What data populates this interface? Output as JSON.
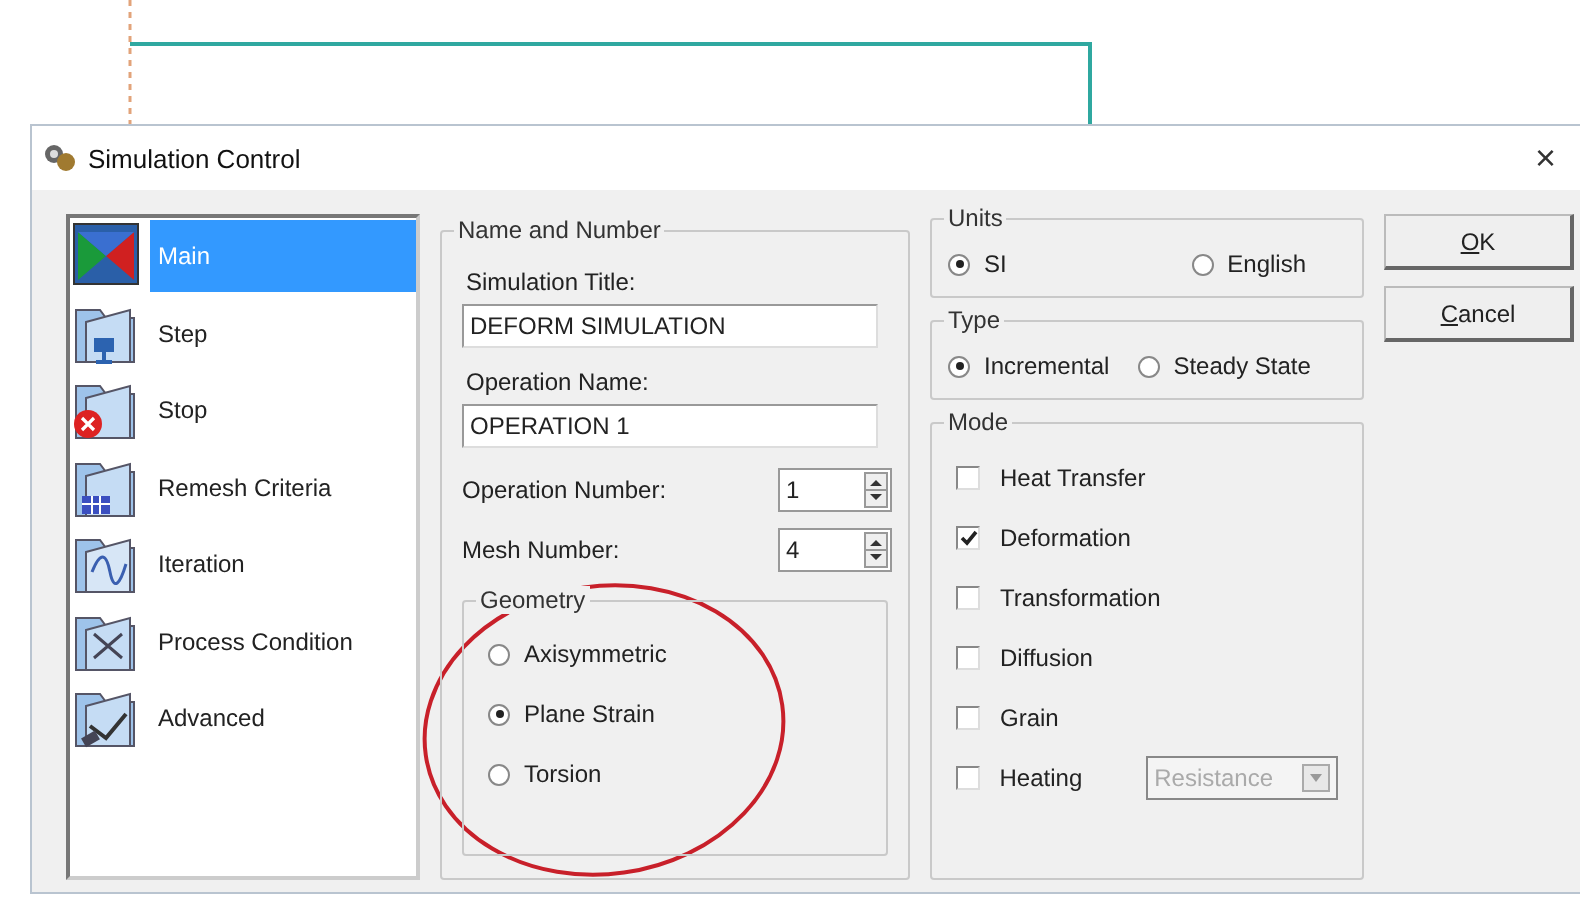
{
  "window": {
    "title": "Simulation Control",
    "close": "×"
  },
  "sidebar": {
    "items": [
      {
        "label": "Main",
        "selected": true
      },
      {
        "label": "Step",
        "selected": false
      },
      {
        "label": "Stop",
        "selected": false
      },
      {
        "label": "Remesh Criteria",
        "selected": false
      },
      {
        "label": "Iteration",
        "selected": false
      },
      {
        "label": "Process Condition",
        "selected": false
      },
      {
        "label": "Advanced",
        "selected": false
      }
    ]
  },
  "name_and_number": {
    "title": "Name and Number",
    "fields": [
      {
        "label": "Simulation Title:",
        "value": "DEFORM SIMULATION"
      },
      {
        "label": "Operation Name:",
        "value": "OPERATION 1"
      }
    ],
    "spinners": [
      {
        "label": "Operation Number:",
        "value": "1"
      },
      {
        "label": "Mesh Number:",
        "value": "4"
      }
    ],
    "geometry": {
      "title": "Geometry",
      "options": [
        {
          "label": "Axisymmetric",
          "selected": false
        },
        {
          "label": "Plane Strain",
          "selected": true
        },
        {
          "label": "Torsion",
          "selected": false
        }
      ]
    }
  },
  "units": {
    "title": "Units",
    "options": [
      {
        "label": "SI",
        "selected": true
      },
      {
        "label": "English",
        "selected": false
      }
    ]
  },
  "type": {
    "title": "Type",
    "options": [
      {
        "label": "Incremental",
        "selected": true
      },
      {
        "label": "Steady State",
        "selected": false
      }
    ]
  },
  "mode": {
    "title": "Mode",
    "options": [
      {
        "label": "Heat Transfer",
        "checked": false
      },
      {
        "label": "Deformation",
        "checked": true
      },
      {
        "label": "Transformation",
        "checked": false
      },
      {
        "label": "Diffusion",
        "checked": false
      },
      {
        "label": "Grain",
        "checked": false
      },
      {
        "label": "Heating",
        "checked": false
      }
    ],
    "heating_method": {
      "value": "Resistance",
      "disabled": true
    }
  },
  "buttons": [
    {
      "label": "OK"
    },
    {
      "label": "Cancel"
    }
  ]
}
